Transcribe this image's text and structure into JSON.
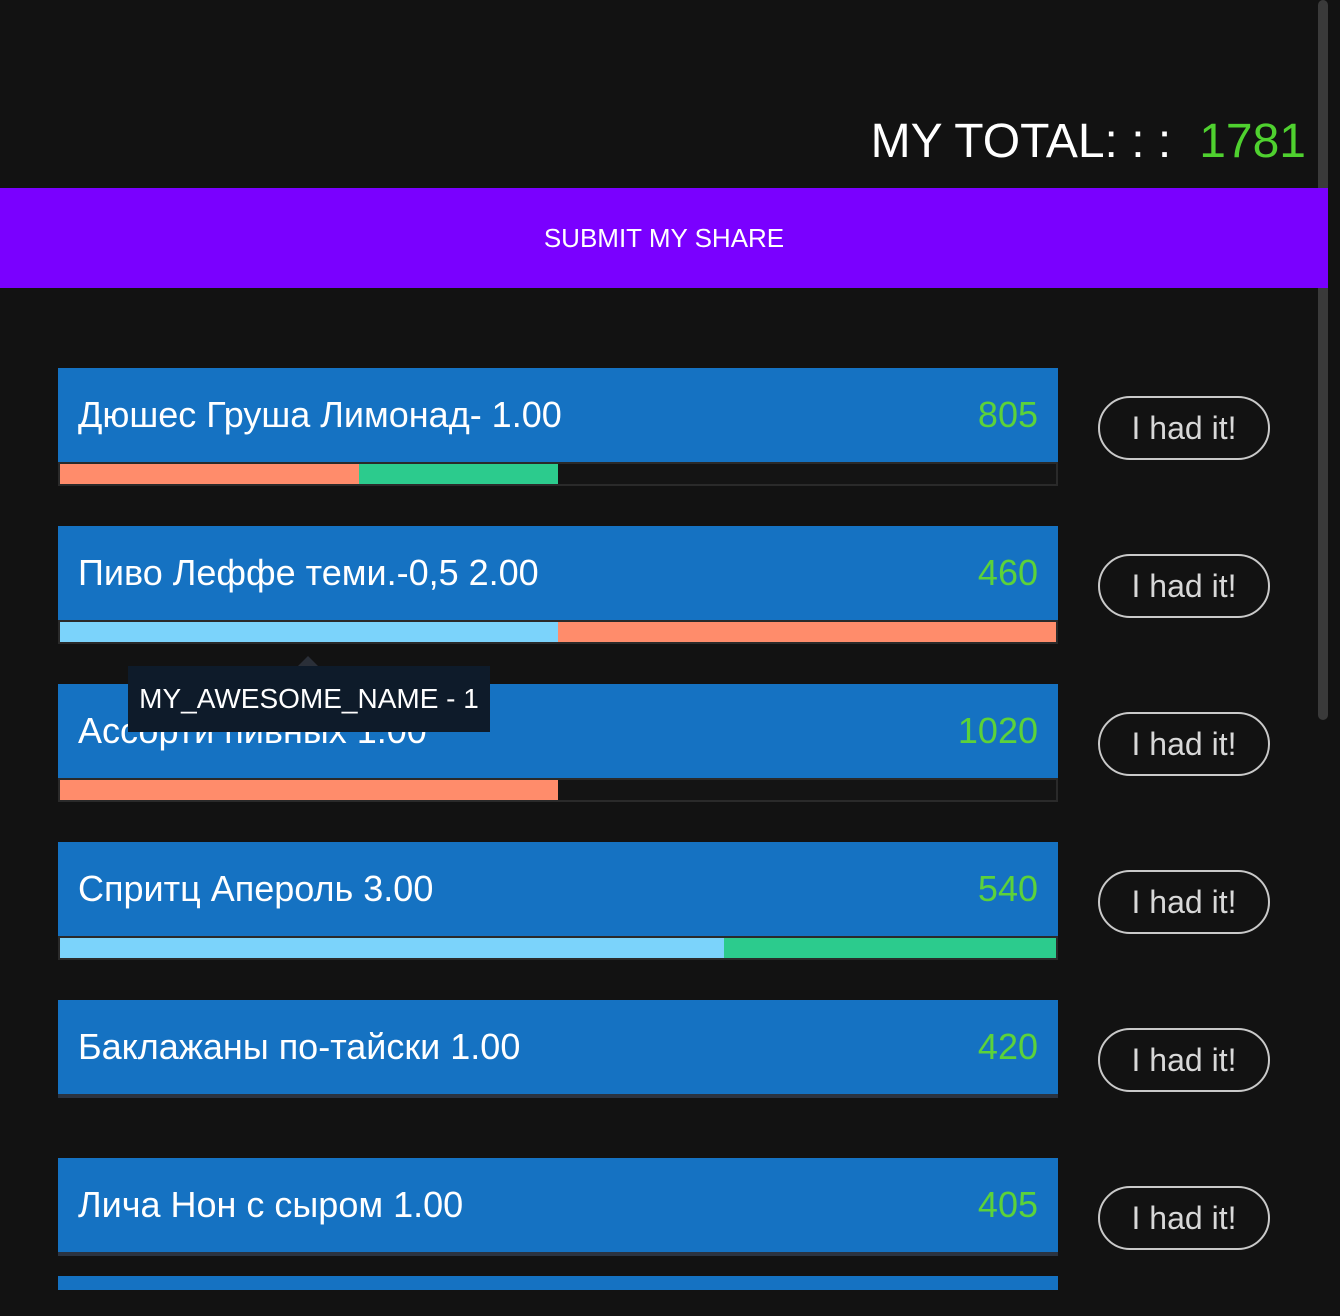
{
  "header": {
    "total_label": "MY TOTAL: : :",
    "total_value": "1781"
  },
  "submit": {
    "label": "SUBMIT MY SHARE"
  },
  "colors": {
    "salmon": "#ff8c6b",
    "green": "#2ccb8d",
    "lightblue": "#7bd3fb",
    "accent": "#7a00ff",
    "item_bg": "#1572c2",
    "price": "#5cd23a"
  },
  "items": [
    {
      "name": "Дюшес Груша Лимонад- 1.00",
      "price": "805",
      "segments": [
        {
          "share": 0.3,
          "color": "#ff8c6b"
        },
        {
          "share": 0.2,
          "color": "#2ccb8d"
        }
      ]
    },
    {
      "name": "Пиво Леффе теми.-0,5 2.00",
      "price": "460",
      "segments": [
        {
          "share": 0.5,
          "color": "#7bd3fb"
        },
        {
          "share": 0.5,
          "color": "#ff8c6b"
        }
      ]
    },
    {
      "name": "Ассорти пивных 1.00",
      "price": "1020",
      "segments": [
        {
          "share": 0.5,
          "color": "#ff8c6b"
        }
      ]
    },
    {
      "name": "Спритц Апероль 3.00",
      "price": "540",
      "segments": [
        {
          "share": 0.667,
          "color": "#7bd3fb"
        },
        {
          "share": 0.333,
          "color": "#2ccb8d"
        }
      ]
    },
    {
      "name": "Баклажаны по-тайски 1.00",
      "price": "420",
      "segments": []
    },
    {
      "name": "Лича Нон с сыром 1.00",
      "price": "405",
      "segments": []
    }
  ],
  "had_it_label": "I had it!",
  "tooltip": {
    "text": "MY_AWESOME_NAME - 1"
  }
}
